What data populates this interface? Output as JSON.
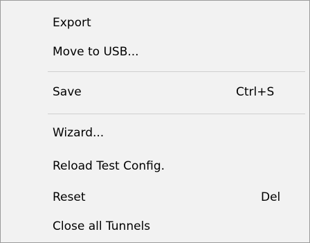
{
  "menu": {
    "items": [
      {
        "label": "Export",
        "shortcut": ""
      },
      {
        "label": "Move to USB...",
        "shortcut": ""
      },
      {
        "label": "Save",
        "shortcut": "Ctrl+S"
      },
      {
        "label": "Wizard...",
        "shortcut": ""
      },
      {
        "label": "Reload Test Config.",
        "shortcut": ""
      },
      {
        "label": "Reset",
        "shortcut": "Del"
      },
      {
        "label": "Close all Tunnels",
        "shortcut": ""
      }
    ]
  }
}
